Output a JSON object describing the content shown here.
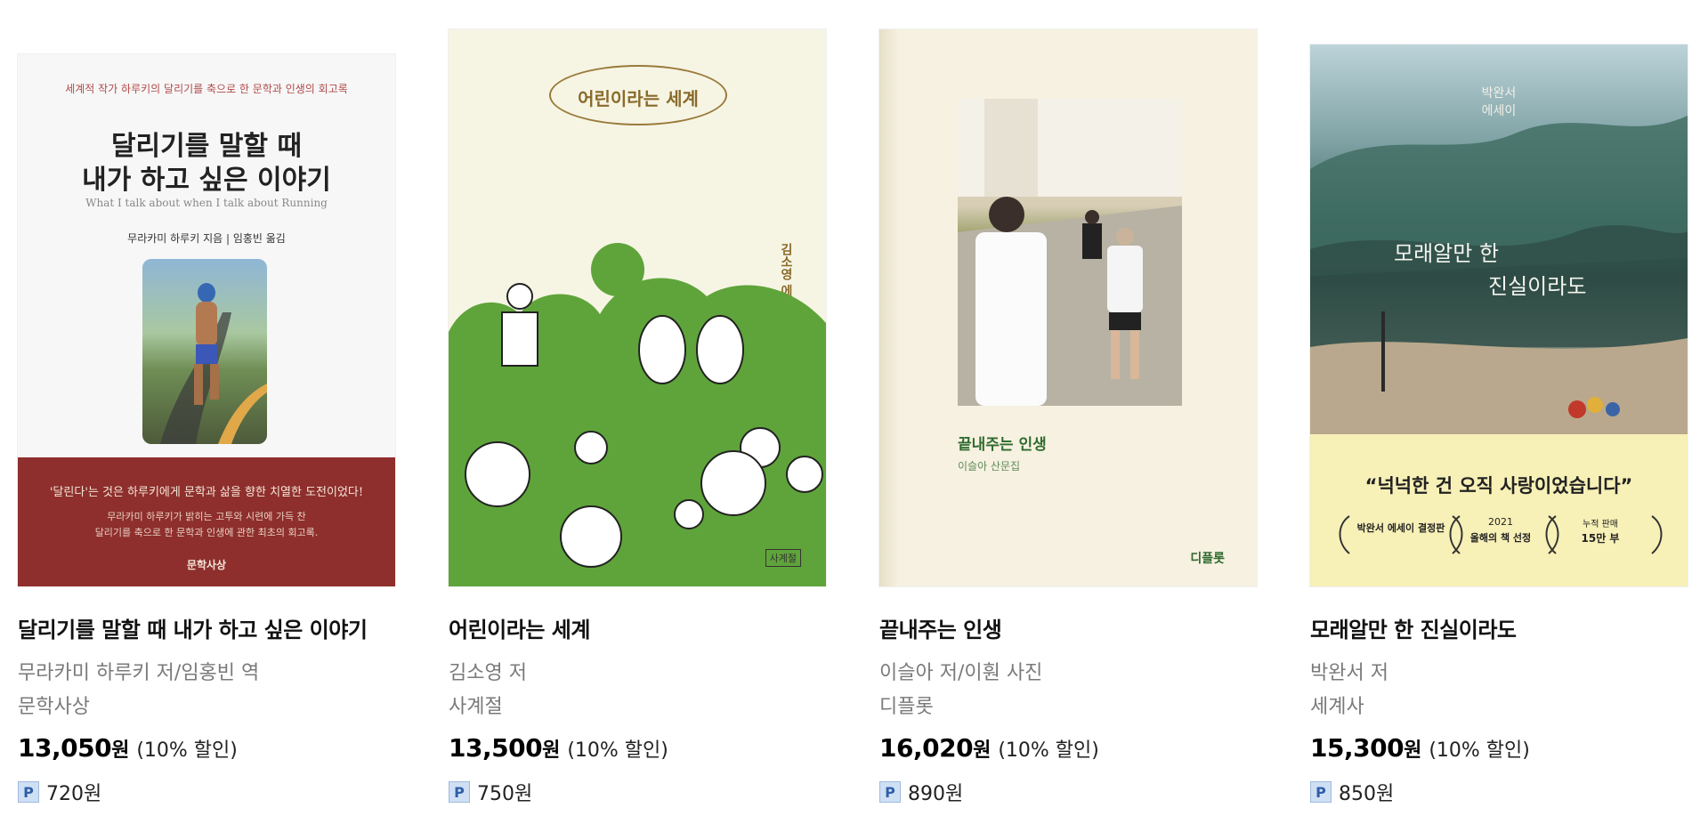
{
  "books": [
    {
      "title": "달리기를 말할 때 내가 하고 싶은 이야기",
      "author": "무라카미 하루키 저/임홍빈 역",
      "publisher": "문학사상",
      "price": "13,050",
      "currency": "원",
      "discount": "(10% 할인)",
      "points": "720원",
      "cover": {
        "top_line": "세계적 작가 하루키의 달리기를 축으로 한 문학과 인생의 회고록",
        "main_title_1": "달리기를 말할 때",
        "main_title_2": "내가 하고 싶은 이야기",
        "english_title": "What I talk about when I talk about Running",
        "byline": "무라카미 하루키 지음 | 임홍빈 옮김",
        "band_line_1": "'달린다'는 것은 하루키에게 문학과 삶을 향한 치열한 도전이었다!",
        "band_line_2": "무라카미 하루키가 밝히는 고투와 시련에 가득 찬",
        "band_line_3": "달리기를 축으로 한 문학과 인생에 관한 최초의 회고록.",
        "band_publisher": "문학사상"
      }
    },
    {
      "title": "어린이라는 세계",
      "author": "김소영 저",
      "publisher": "사계절",
      "price": "13,500",
      "currency": "원",
      "discount": "(10% 할인)",
      "points": "750원",
      "cover": {
        "oval_title": "어린이라는 세계",
        "vertical_author": "김소영 에세이",
        "publisher_logo": "사계절"
      }
    },
    {
      "title": "끝내주는 인생",
      "author": "이슬아 저/이훤 사진",
      "publisher": "디플롯",
      "price": "16,020",
      "currency": "원",
      "discount": "(10% 할인)",
      "points": "890원",
      "cover": {
        "title": "끝내주는 인생",
        "subtitle": "이슬아 산문집",
        "publisher_logo": "디플롯"
      }
    },
    {
      "title": "모래알만 한 진실이라도",
      "author": "박완서 저",
      "publisher": "세계사",
      "price": "15,300",
      "currency": "원",
      "discount": "(10% 할인)",
      "points": "850원",
      "cover": {
        "top_label_1": "박완서",
        "top_label_2": "에세이",
        "title_line_1": "모래알만 한",
        "title_line_2": "진실이라도",
        "quote": "“넉넉한 건 오직 사랑이었습니다”",
        "award_1": "박완서 에세이 결정판",
        "award_2_year": "2021",
        "award_2": "올해의 책 선정",
        "award_3_label": "누적 판매",
        "award_3": "15만 부"
      }
    }
  ],
  "colors": {
    "book1_band": "#8e2f2d",
    "book2_green": "#5fa43a",
    "book3_bg": "#f6f1e0",
    "book4_bottom": "#f7f0b7"
  }
}
